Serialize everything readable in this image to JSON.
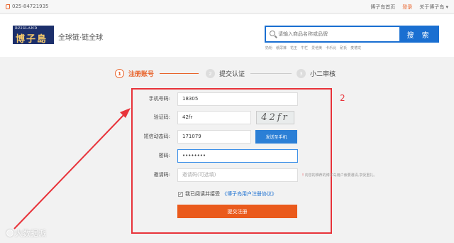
{
  "topbar": {
    "phone": "025-84721935",
    "links": [
      "博子岛首页",
      "登录",
      "关于博子岛 ▾"
    ]
  },
  "header": {
    "logo_top": "BZISLAND",
    "logo_main": "博子島",
    "slogan": "全球链·链全球",
    "search_placeholder": "请输入商品名称或品牌",
    "search_button": "搜 索",
    "hot_words": [
      "奶粉",
      "纸尿裤",
      "花王",
      "牛栏",
      "爱他美",
      "卡乐比",
      "耐氏",
      "麦德龙"
    ]
  },
  "steps": [
    {
      "num": "1",
      "label": "注册账号"
    },
    {
      "num": "2",
      "label": "提交认证"
    },
    {
      "num": "3",
      "label": "小二审核"
    }
  ],
  "annotation_number": "2",
  "form": {
    "phone_label": "手机号码:",
    "phone_value": "18305",
    "captcha_label": "验证码:",
    "captcha_value": "42fr",
    "captcha_image_text": "42fr",
    "sms_label": "短信动态码:",
    "sms_value": "171079",
    "sms_button": "发送至手机",
    "password_label": "密码:",
    "password_value": "••••••••",
    "invite_label": "邀请码:",
    "invite_placeholder": "邀请码(可选填)",
    "invite_hint": "向您的推荐的博子岛用户索要邀请,享受重礼。",
    "agree_text": "我已阅读并接受",
    "agree_link": "《博子岛用户注册协议》",
    "submit_button": "提交注册"
  },
  "watermark": "大数据派",
  "colors": {
    "accent_orange": "#ea5a1c",
    "brand_blue": "#1a6fd1",
    "annotation_red": "#e8333a"
  }
}
